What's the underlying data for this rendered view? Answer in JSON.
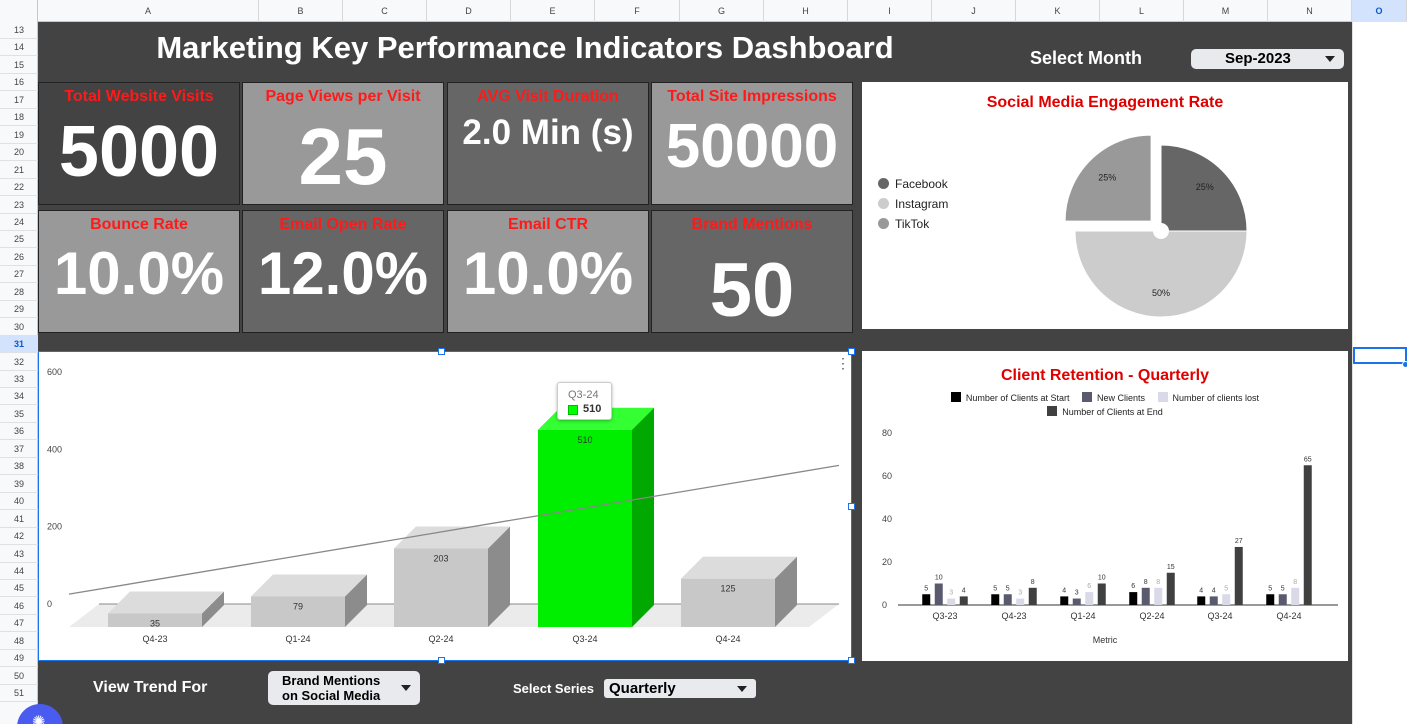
{
  "columns": [
    "A",
    "B",
    "C",
    "D",
    "E",
    "F",
    "G",
    "H",
    "I",
    "J",
    "K",
    "L",
    "M",
    "N",
    "O"
  ],
  "rows": [
    "13",
    "14",
    "15",
    "16",
    "17",
    "18",
    "19",
    "20",
    "21",
    "22",
    "23",
    "24",
    "25",
    "26",
    "27",
    "28",
    "29",
    "30",
    "31",
    "32",
    "33",
    "34",
    "35",
    "36",
    "37",
    "38",
    "39",
    "40",
    "41",
    "42",
    "43",
    "44",
    "45",
    "46",
    "47",
    "48",
    "49",
    "50",
    "51"
  ],
  "dashboard": {
    "title": "Marketing Key Performance Indicators Dashboard",
    "month_label": "Select Month",
    "month_value": "Sep-2023"
  },
  "kpis": [
    {
      "label": "Total Website Visits",
      "value": "5000"
    },
    {
      "label": "Page Views per Visit",
      "value": "25"
    },
    {
      "label": "AVG Visit Duration",
      "value": "2.0 Min (s)"
    },
    {
      "label": "Total Site Impressions",
      "value": "50000"
    },
    {
      "label": "Bounce Rate",
      "value": "10.0%"
    },
    {
      "label": "Email Open Rate",
      "value": "12.0%"
    },
    {
      "label": "Email CTR",
      "value": "10.0%"
    },
    {
      "label": "Brand Mentions",
      "value": "50"
    }
  ],
  "colors": {
    "sheet_bg": "#434343",
    "kpi_label": "#ff1a1a",
    "chart_title": "#e00000",
    "highlight_bar": "#00ff00",
    "selection": "#1a73e8"
  },
  "controls": {
    "trend_label": "View Trend For",
    "trend_value_line1": "Brand Mentions",
    "trend_value_line2": "on Social Media",
    "series_label": "Select Series",
    "series_value": "Quarterly"
  },
  "chart_data": [
    {
      "type": "pie",
      "title": "Social Media Engagement Rate",
      "labels": [
        "Facebook",
        "Instagram",
        "TikTok"
      ],
      "values": [
        25,
        50,
        25
      ],
      "data_labels": [
        "25%",
        "50%",
        "25%"
      ],
      "colors": [
        "#666666",
        "#cccccc",
        "#999999"
      ],
      "exploded": "TikTok",
      "legend": "left"
    },
    {
      "type": "bar",
      "style": "3d",
      "categories": [
        "Q4-23",
        "Q1-24",
        "Q2-24",
        "Q3-24",
        "Q4-24"
      ],
      "values": [
        35,
        79,
        203,
        510,
        125
      ],
      "highlight": "Q3-24",
      "trendline": "linear",
      "ylim": [
        0,
        600
      ],
      "yticks": [
        "0",
        "200",
        "400",
        "600"
      ],
      "tooltip": {
        "category": "Q3-24",
        "value": "510"
      }
    },
    {
      "type": "bar",
      "title": "Client Retention - Quarterly",
      "categories": [
        "Q3-23",
        "Q4-23",
        "Q1-24",
        "Q2-24",
        "Q3-24",
        "Q4-24"
      ],
      "series": [
        {
          "name": "Number of Clients at Start",
          "values": [
            5,
            5,
            4,
            6,
            4,
            5
          ],
          "color": "#000000"
        },
        {
          "name": "New Clients",
          "values": [
            10,
            5,
            3,
            8,
            4,
            5
          ],
          "color": "#5a5a6e"
        },
        {
          "name": "Number of clients lost",
          "values": [
            3,
            3,
            6,
            8,
            5,
            8
          ],
          "color": "#d9d9e8"
        },
        {
          "name": "Number of Clients at End",
          "values": [
            4,
            8,
            10,
            15,
            27,
            65
          ],
          "color": "#404040"
        }
      ],
      "xlabel": "Metric",
      "ylim": [
        0,
        80
      ],
      "yticks": [
        "0",
        "20",
        "40",
        "60",
        "80"
      ],
      "legend": "top"
    }
  ]
}
